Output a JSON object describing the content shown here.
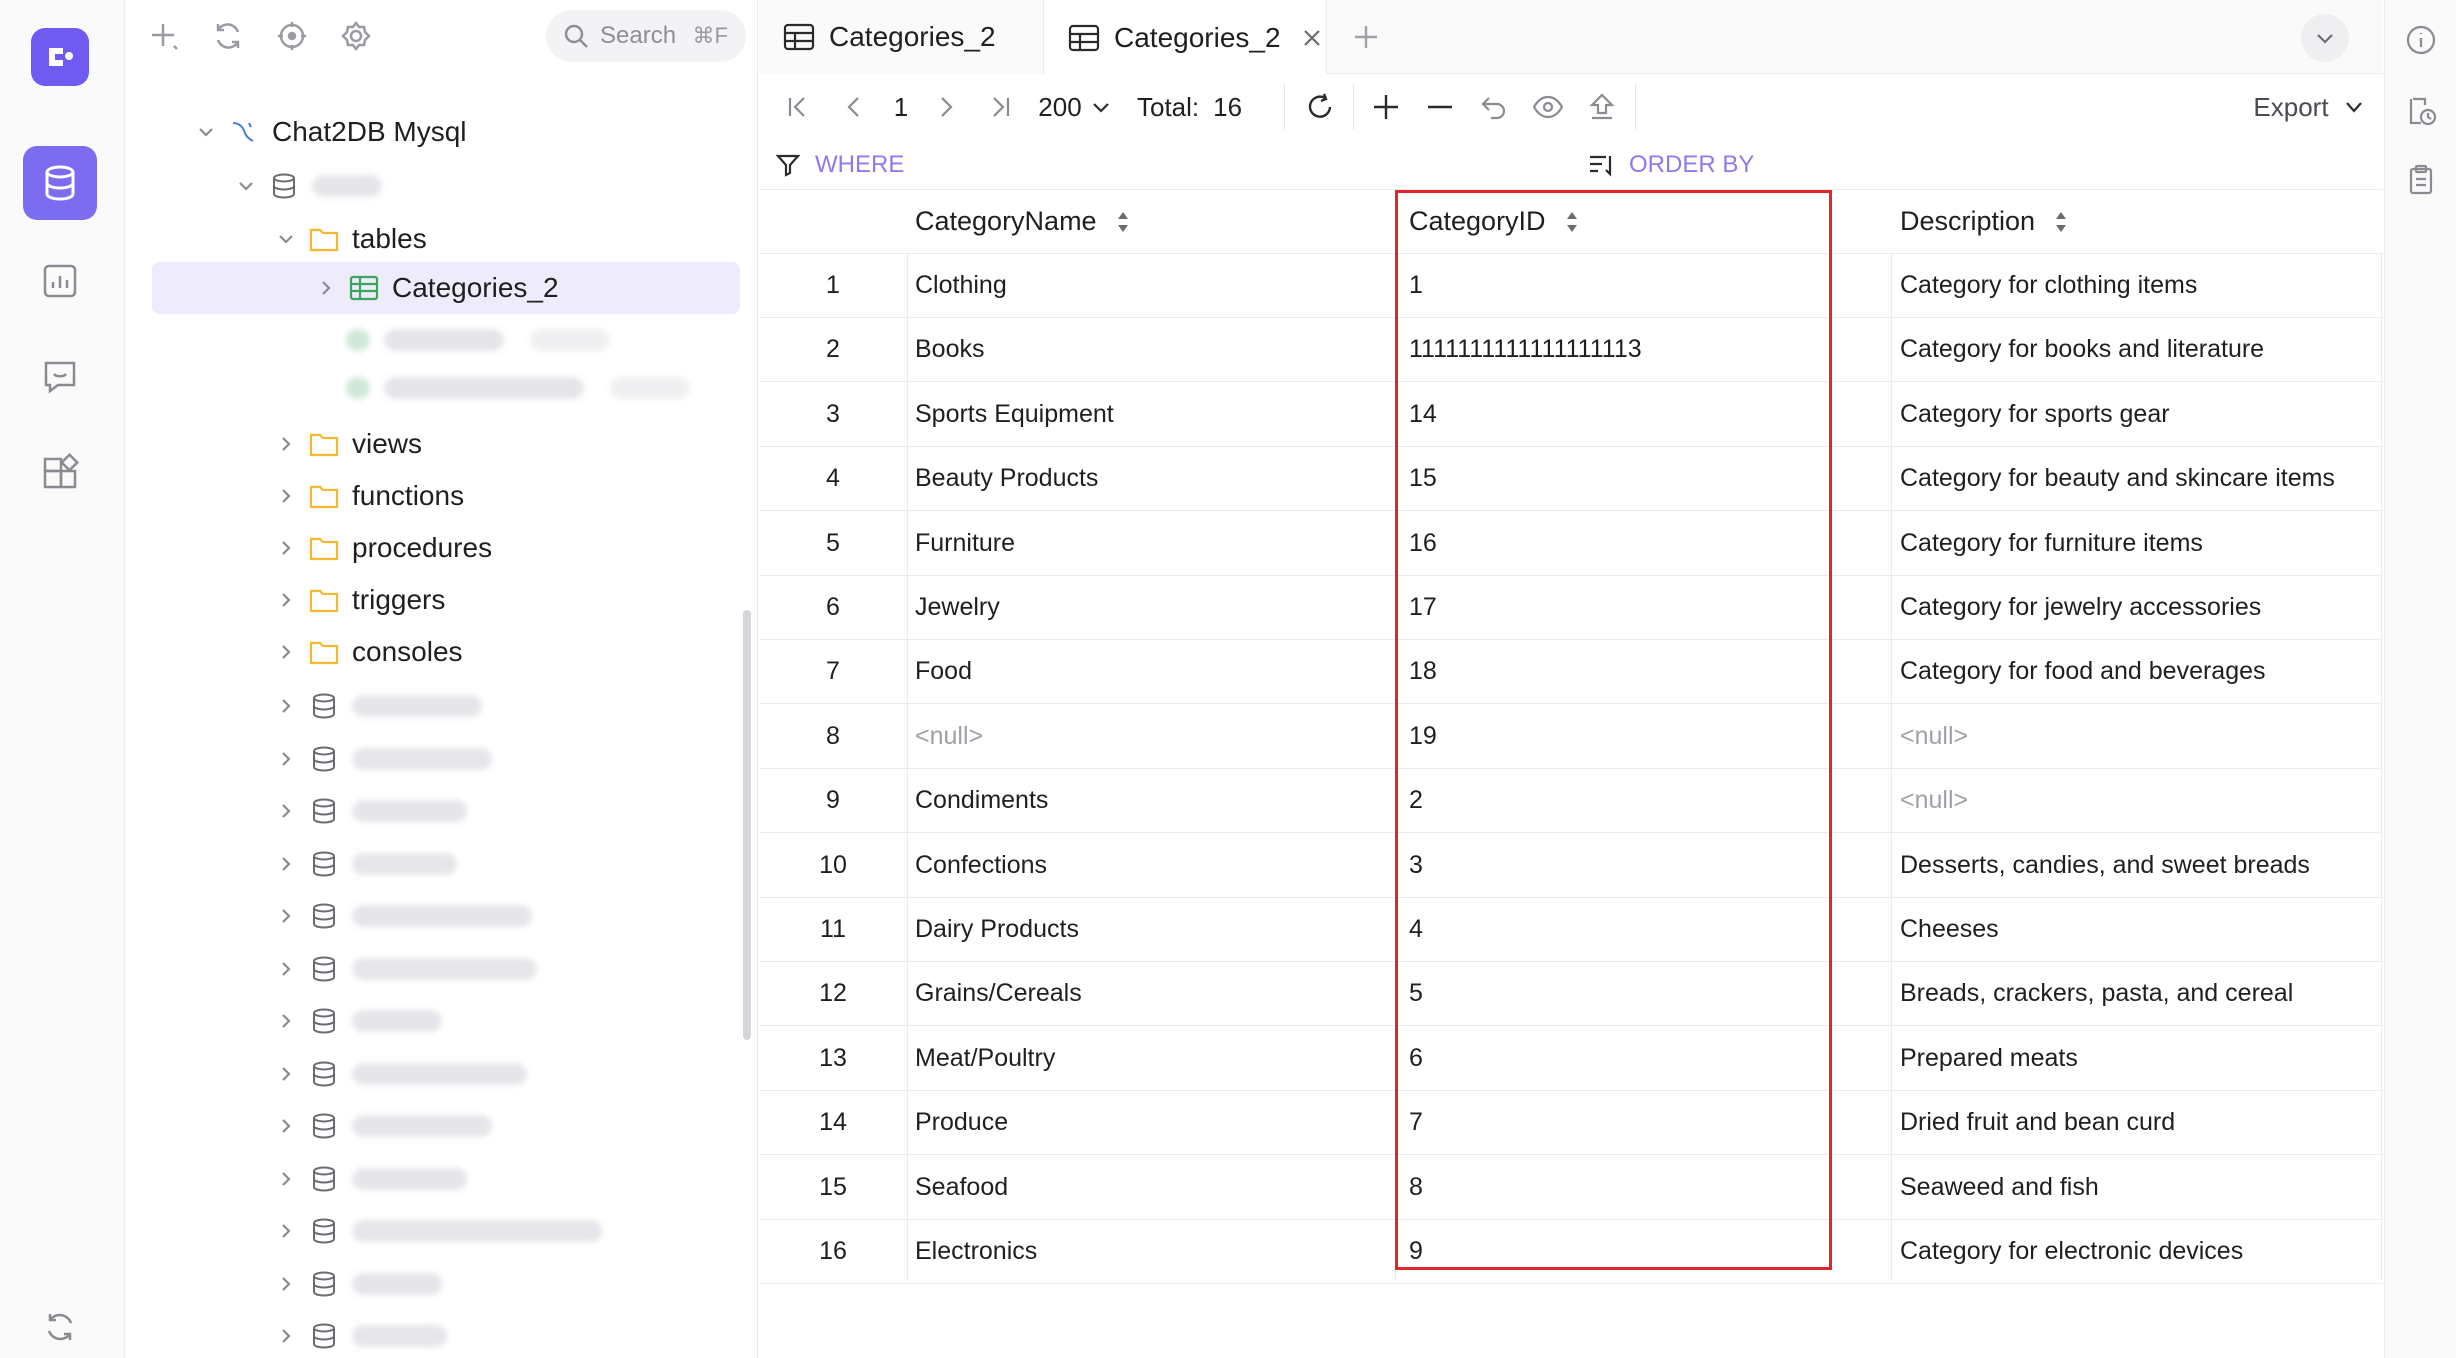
{
  "search": {
    "label": "Search",
    "shortcut": "⌘F"
  },
  "tree": {
    "connection": "Chat2DB Mysql",
    "tables_folder": "tables",
    "selected_table": "Categories_2",
    "folders": [
      "views",
      "functions",
      "procedures",
      "triggers",
      "consoles"
    ]
  },
  "tabs": [
    {
      "label": "Categories_2"
    },
    {
      "label": "Categories_2"
    }
  ],
  "toolbar": {
    "page": "1",
    "page_size": "200",
    "total_label": "Total:",
    "total_value": "16",
    "export_label": "Export"
  },
  "filter": {
    "where_label": "WHERE",
    "order_label": "ORDER BY"
  },
  "grid": {
    "columns": [
      "CategoryName",
      "CategoryID",
      "Description"
    ],
    "rows": [
      {
        "idx": "1",
        "name": "Clothing",
        "id": "1",
        "desc": "Category for clothing items"
      },
      {
        "idx": "2",
        "name": "Books",
        "id": "1111111111111111113",
        "desc": "Category for books and literature"
      },
      {
        "idx": "3",
        "name": "Sports Equipment",
        "id": "14",
        "desc": "Category for sports gear"
      },
      {
        "idx": "4",
        "name": "Beauty Products",
        "id": "15",
        "desc": "Category for beauty and skincare items"
      },
      {
        "idx": "5",
        "name": "Furniture",
        "id": "16",
        "desc": "Category for furniture items"
      },
      {
        "idx": "6",
        "name": "Jewelry",
        "id": "17",
        "desc": "Category for jewelry accessories"
      },
      {
        "idx": "7",
        "name": "Food",
        "id": "18",
        "desc": "Category for food and beverages"
      },
      {
        "idx": "8",
        "name": "<null>",
        "id": "19",
        "desc": "<null>"
      },
      {
        "idx": "9",
        "name": "Condiments",
        "id": "2",
        "desc": "<null>"
      },
      {
        "idx": "10",
        "name": "Confections",
        "id": "3",
        "desc": "Desserts, candies, and sweet breads"
      },
      {
        "idx": "11",
        "name": "Dairy Products",
        "id": "4",
        "desc": "Cheeses"
      },
      {
        "idx": "12",
        "name": "Grains/Cereals",
        "id": "5",
        "desc": "Breads, crackers, pasta, and cereal"
      },
      {
        "idx": "13",
        "name": "Meat/Poultry",
        "id": "6",
        "desc": "Prepared meats"
      },
      {
        "idx": "14",
        "name": "Produce",
        "id": "7",
        "desc": "Dried fruit and bean curd"
      },
      {
        "idx": "15",
        "name": "Seafood",
        "id": "8",
        "desc": "Seaweed and fish"
      },
      {
        "idx": "16",
        "name": "Electronics",
        "id": "9",
        "desc": "Category for electronic devices"
      }
    ]
  },
  "colors": {
    "accent": "#7c6cf0",
    "highlight": "#e0252b",
    "folder": "#f5c542",
    "table": "#3aa55c"
  }
}
